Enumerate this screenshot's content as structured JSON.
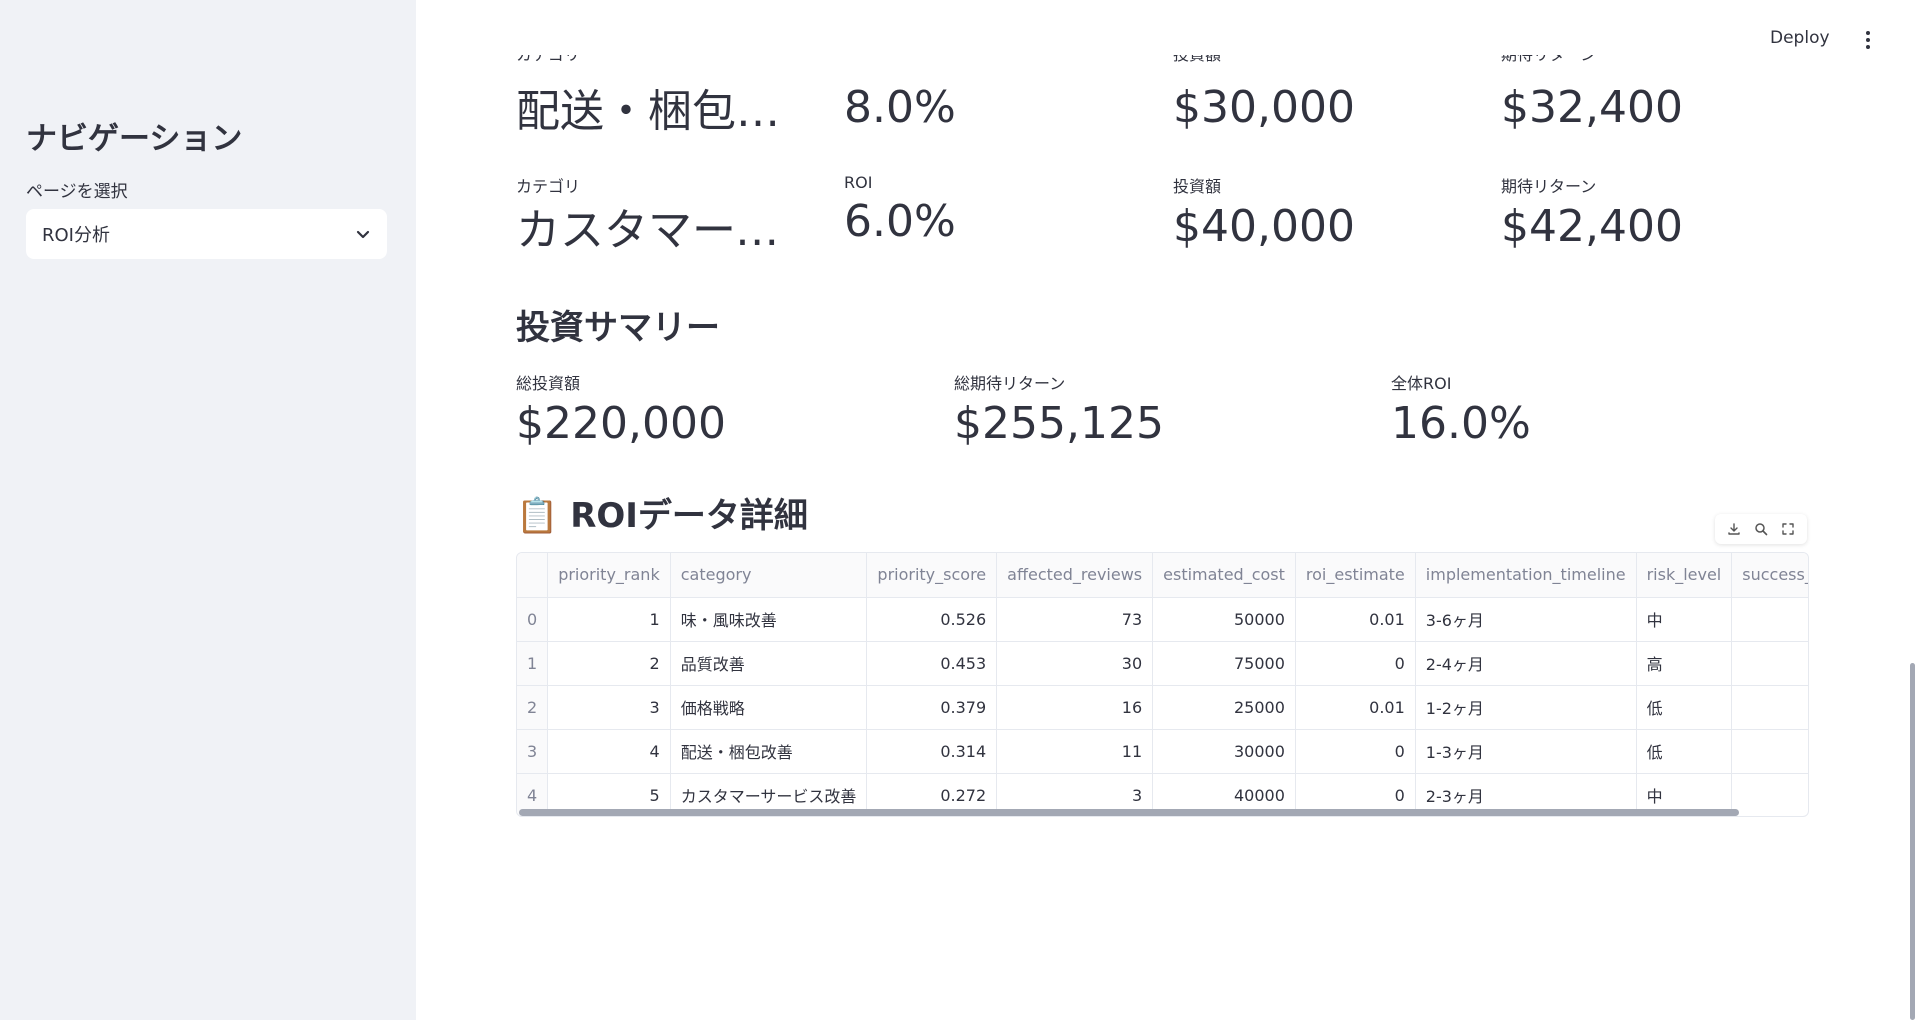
{
  "sidebar": {
    "title": "ナビゲーション",
    "select_label": "ページを選択",
    "select_value": "ROI分析"
  },
  "header": {
    "deploy_label": "Deploy"
  },
  "metric_row_1": {
    "category_value": "配送・梱包改善",
    "roi_value": "8.0%",
    "investment_value": "$30,000",
    "expected_return_value": "$32,400"
  },
  "metric_row_2": {
    "category_label": "カテゴリ",
    "category_value": "カスタマーサービス改善",
    "roi_label": "ROI",
    "roi_value": "6.0%",
    "investment_label": "投資額",
    "investment_value": "$40,000",
    "expected_return_label": "期待リターン",
    "expected_return_value": "$42,400"
  },
  "summary": {
    "heading": "投資サマリー",
    "total_investment_label": "総投資額",
    "total_investment_value": "$220,000",
    "total_return_label": "総期待リターン",
    "total_return_value": "$255,125",
    "overall_roi_label": "全体ROI",
    "overall_roi_value": "16.0%"
  },
  "detail": {
    "heading_icon": "📋",
    "heading": "ROIデータ詳細"
  },
  "table": {
    "columns": [
      "",
      "priority_rank",
      "category",
      "priority_score",
      "affected_reviews",
      "estimated_cost",
      "roi_estimate",
      "implementation_timeline",
      "risk_level",
      "success_pr"
    ],
    "rows": [
      [
        "0",
        "1",
        "味・風味改善",
        "0.526",
        "73",
        "50000",
        "0.01",
        "3-6ヶ月",
        "中"
      ],
      [
        "1",
        "2",
        "品質改善",
        "0.453",
        "30",
        "75000",
        "0",
        "2-4ヶ月",
        "高"
      ],
      [
        "2",
        "3",
        "価格戦略",
        "0.379",
        "16",
        "25000",
        "0.01",
        "1-2ヶ月",
        "低"
      ],
      [
        "3",
        "4",
        "配送・梱包改善",
        "0.314",
        "11",
        "30000",
        "0",
        "1-3ヶ月",
        "低"
      ],
      [
        "4",
        "5",
        "カスタマーサービス改善",
        "0.272",
        "3",
        "40000",
        "0",
        "2-3ヶ月",
        "中"
      ]
    ]
  },
  "icons": {
    "chevron": "chevron-down-icon",
    "menu": "kebab-menu-icon",
    "download": "download-icon",
    "search": "search-icon",
    "fullscreen": "fullscreen-icon"
  }
}
